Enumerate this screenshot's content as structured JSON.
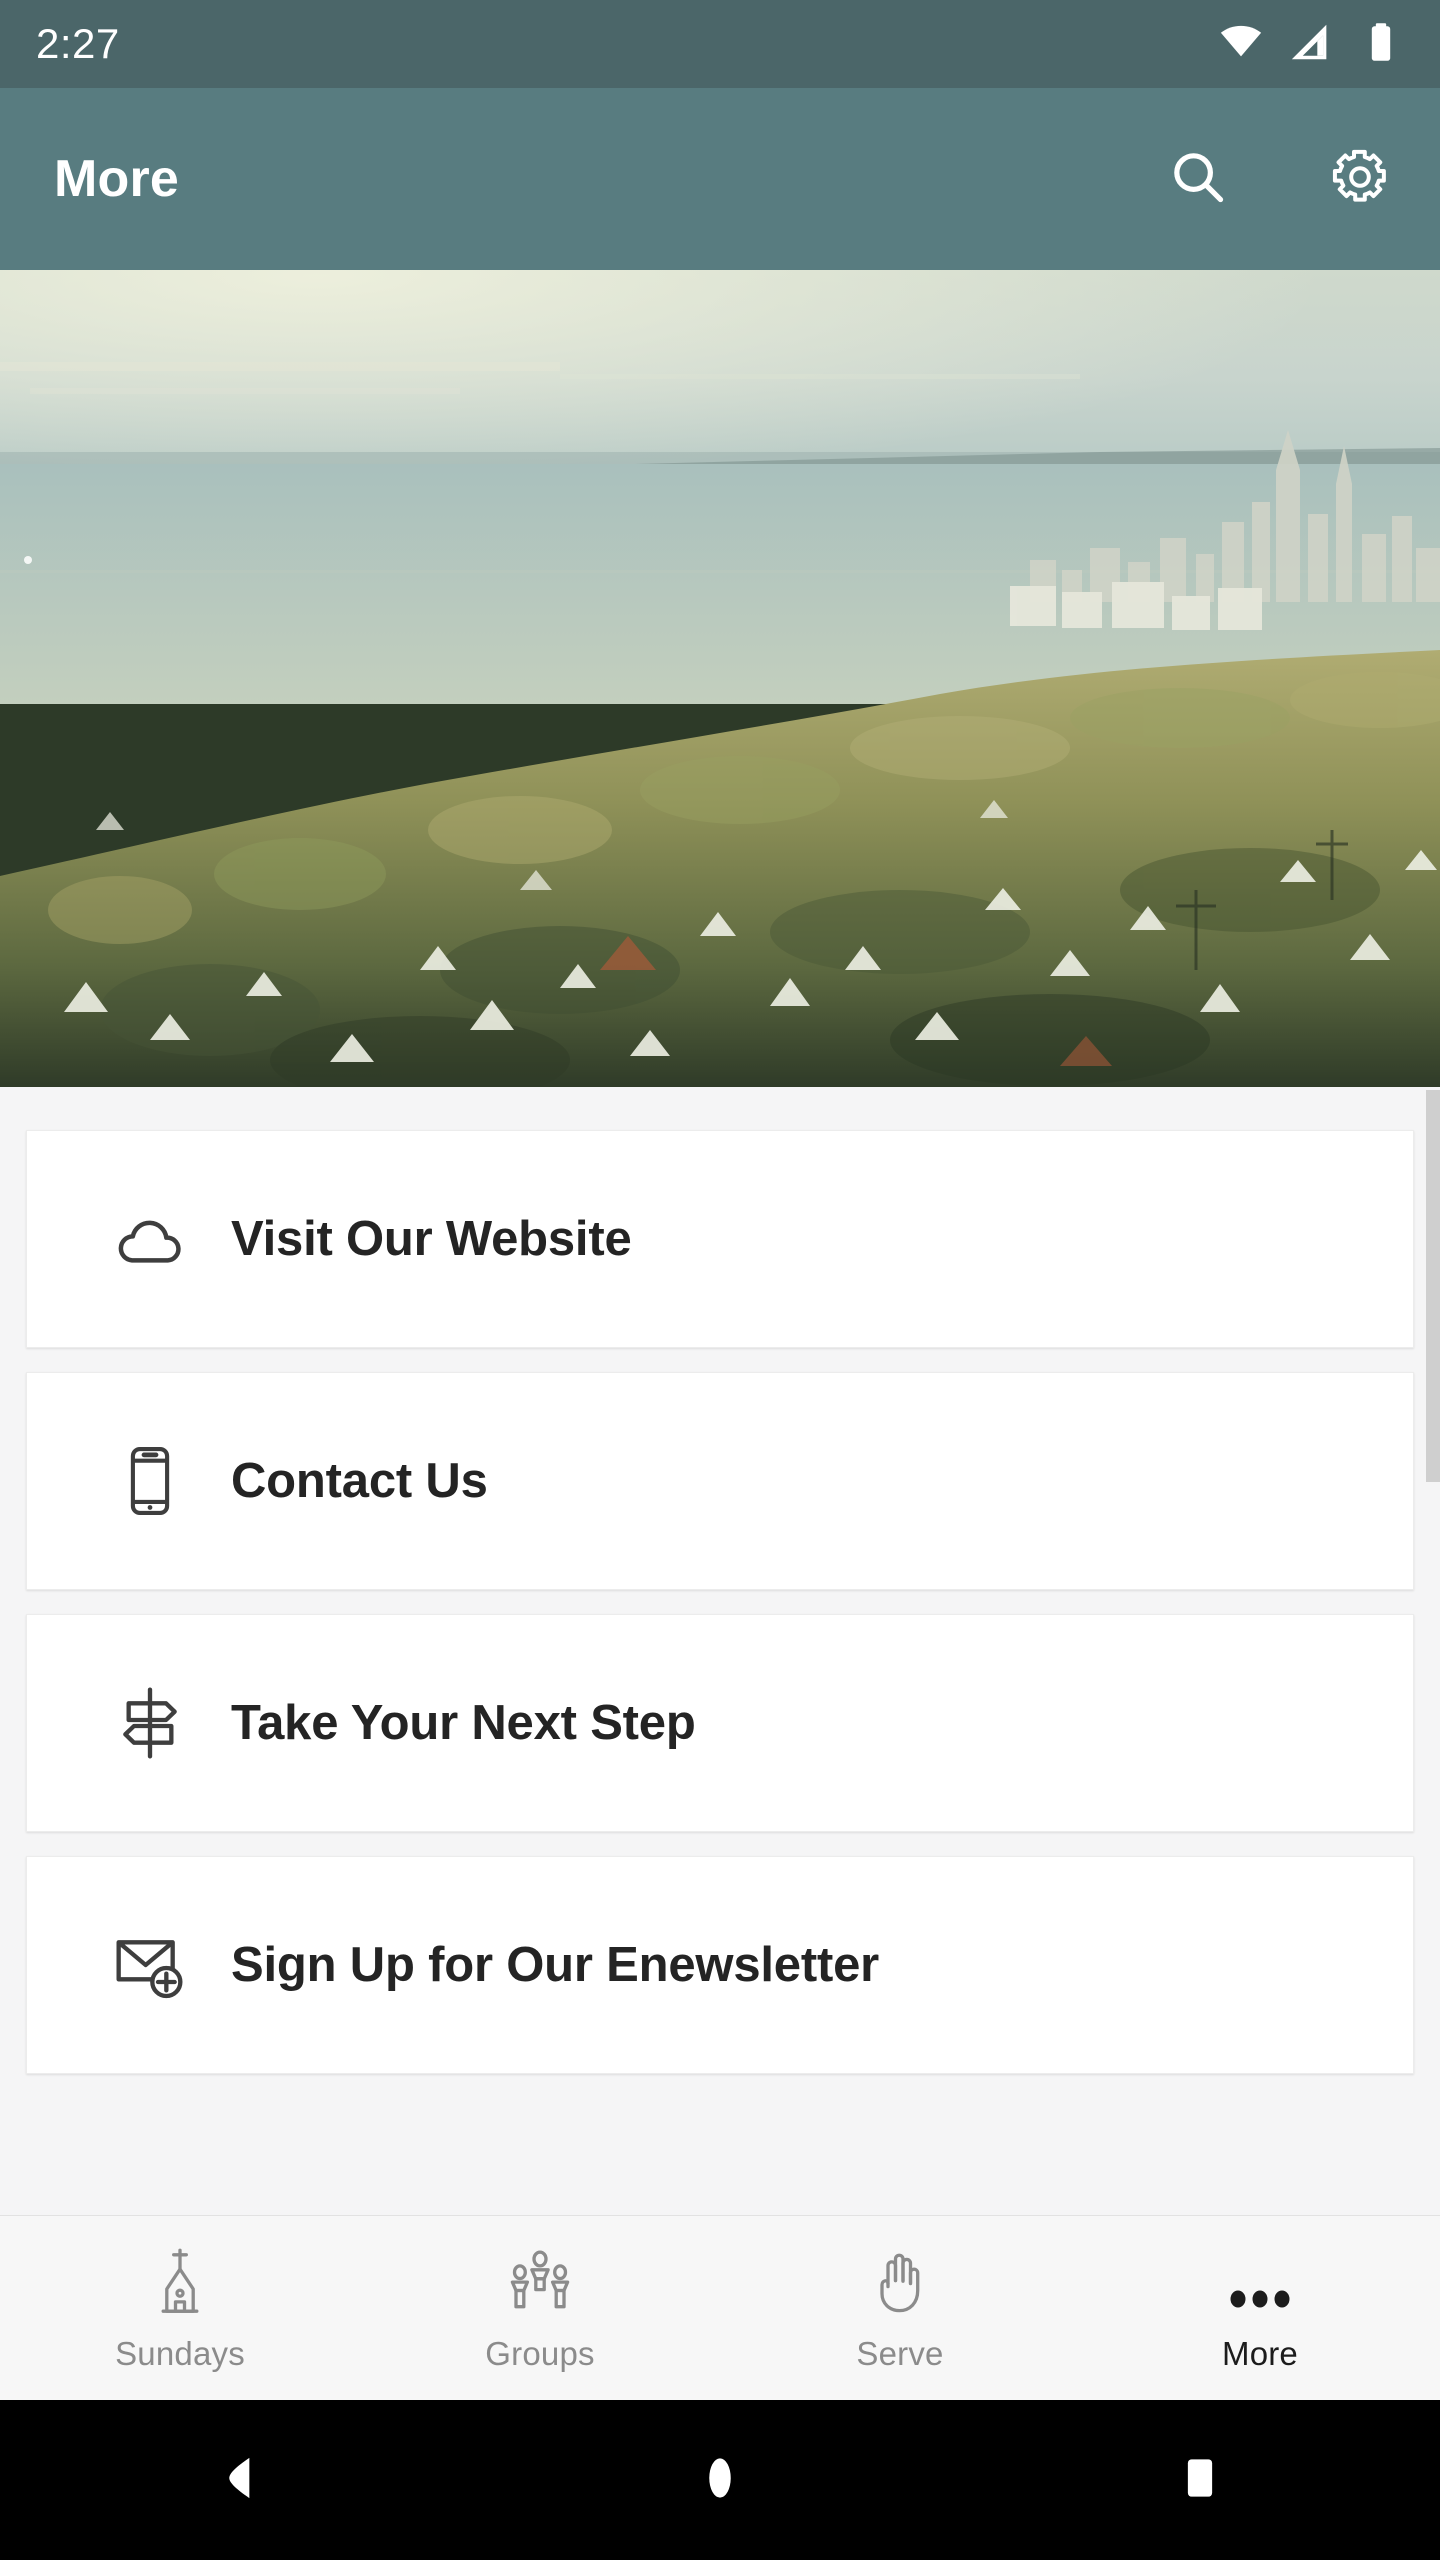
{
  "status_bar": {
    "time": "2:27",
    "icons": [
      "wifi-icon",
      "cellular-signal-icon",
      "battery-icon"
    ]
  },
  "app_bar": {
    "title": "More",
    "actions": [
      {
        "name": "search-icon",
        "label": "Search"
      },
      {
        "name": "gear-icon",
        "label": "Settings"
      }
    ]
  },
  "hero": {
    "alt": "Aerial photo of a tree-filled suburban neighborhood beside a lake with a distant city skyline"
  },
  "menu": {
    "items": [
      {
        "label": "Visit Our Website",
        "icon": "cloud-icon"
      },
      {
        "label": "Contact Us",
        "icon": "mobile-phone-icon"
      },
      {
        "label": "Take Your Next Step",
        "icon": "signpost-icon"
      },
      {
        "label": "Sign Up for Our Enewsletter",
        "icon": "envelope-plus-icon"
      }
    ]
  },
  "bottom_nav": {
    "items": [
      {
        "label": "Sundays",
        "icon": "church-icon",
        "active": false
      },
      {
        "label": "Groups",
        "icon": "people-group-icon",
        "active": false
      },
      {
        "label": "Serve",
        "icon": "open-hand-icon",
        "active": false
      },
      {
        "label": "More",
        "icon": "ellipsis-icon",
        "active": true
      }
    ]
  },
  "android_nav": {
    "buttons": [
      "back-icon",
      "home-icon",
      "recents-icon"
    ]
  },
  "colors": {
    "status_bar": "#4b6669",
    "app_bar": "#587c80",
    "page_background": "#f5f5f6",
    "card_background": "#ffffff",
    "card_text": "#242424",
    "nav_inactive": "#8b8b8b",
    "nav_active": "#1c1c1c",
    "scrollbar_thumb": "#cfcfcf"
  }
}
